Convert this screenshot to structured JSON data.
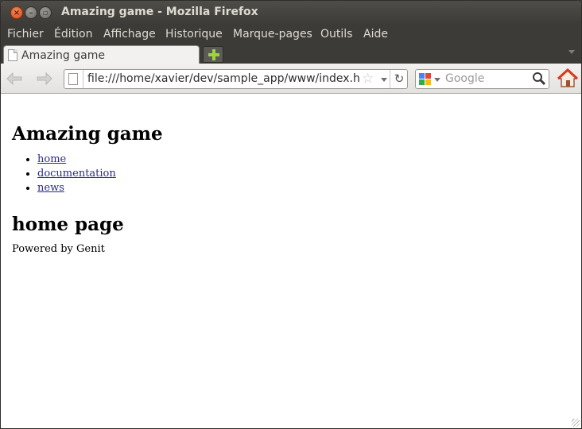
{
  "window": {
    "title": "Amazing game - Mozilla Firefox"
  },
  "menubar": {
    "items": [
      "Fichier",
      "Édition",
      "Affichage",
      "Historique",
      "Marque-pages",
      "Outils",
      "Aide"
    ]
  },
  "tabs": [
    {
      "label": "Amazing game",
      "active": true
    }
  ],
  "navbar": {
    "url": "file:///home/xavier/dev/sample_app/www/index.html",
    "search_engine": "google-icon",
    "search_placeholder": "Google"
  },
  "page": {
    "heading": "Amazing game",
    "nav_links": [
      "home",
      "documentation",
      "news"
    ],
    "subheading": "home page",
    "footer": "Powered by Genit"
  },
  "colors": {
    "titlebar": "#3c3b37",
    "close_button": "#df4a16",
    "link": "#2a2a8c"
  }
}
